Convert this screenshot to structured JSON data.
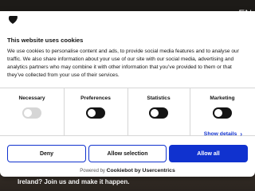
{
  "page": {
    "language": "EN",
    "background_text": "Ireland? Join us and make it happen."
  },
  "dialog": {
    "title": "This website uses cookies",
    "description": "We use cookies to personalise content and ads, to provide social media features and to analyse our traffic. We also share information about your use of our site with our social media, advertising and analytics partners who may combine it with other information that you’ve provided to them or that they’ve collected from your use of their services.",
    "categories": [
      {
        "label": "Necessary",
        "enabled": true,
        "disabled": true
      },
      {
        "label": "Preferences",
        "enabled": false,
        "disabled": false
      },
      {
        "label": "Statistics",
        "enabled": false,
        "disabled": false
      },
      {
        "label": "Marketing",
        "enabled": false,
        "disabled": false
      }
    ],
    "show_details": "Show details",
    "buttons": {
      "deny": "Deny",
      "allow_selection": "Allow selection",
      "allow_all": "Allow all"
    },
    "powered_by": "Powered by",
    "powered_brand": "Cookiebot by Usercentrics"
  },
  "colors": {
    "accent": "#1032cf",
    "text": "#141414",
    "toggle_off": "#141414",
    "toggle_disabled": "#d6d6d6"
  }
}
